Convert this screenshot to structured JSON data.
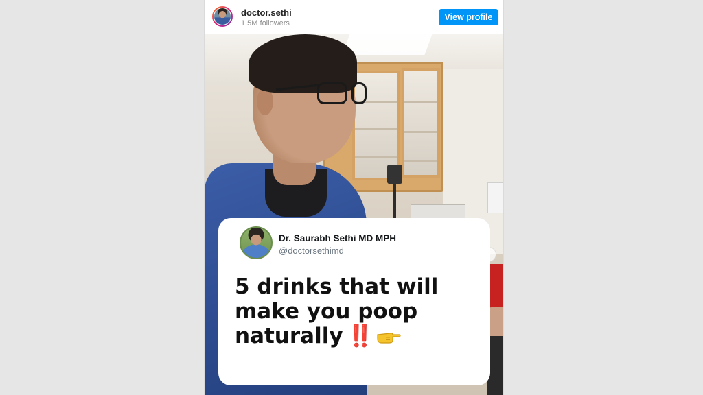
{
  "post": {
    "username": "doctor.sethi",
    "followers": "1.5M followers",
    "view_profile_label": "View profile",
    "next_icon": "chevron-right-icon"
  },
  "card": {
    "name": "Dr. Saurabh Sethi MD MPH",
    "handle": "@doctorsethimd",
    "headline": "5 drinks that will make you poop naturally",
    "emoji_1": "‼️",
    "emoji_2": "👉"
  },
  "colors": {
    "background": "#e6e6e6",
    "button": "#0095f6",
    "card": "#ffffff"
  }
}
